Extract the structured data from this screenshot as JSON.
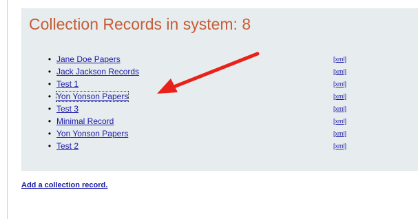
{
  "page": {
    "title": "Collection Records in system: 8",
    "add_link": "Add a collection record."
  },
  "records": [
    {
      "label": "Jane Doe Papers",
      "xml": "[xml]"
    },
    {
      "label": "Jack Jackson Records",
      "xml": "[xml]"
    },
    {
      "label": "Test 1",
      "xml": "[xml]"
    },
    {
      "label": "Yon Yonson Papers",
      "xml": "[xml]"
    },
    {
      "label": "Test 3",
      "xml": "[xml]"
    },
    {
      "label": "Minimal Record",
      "xml": "[xml]"
    },
    {
      "label": "Yon Yonson Papers",
      "xml": "[xml]"
    },
    {
      "label": "Test 2",
      "xml": "[xml]"
    }
  ],
  "colors": {
    "title": "#c55d36",
    "panel": "#e7ecee",
    "link": "#1a1aa6",
    "arrow": "#e8221a"
  }
}
